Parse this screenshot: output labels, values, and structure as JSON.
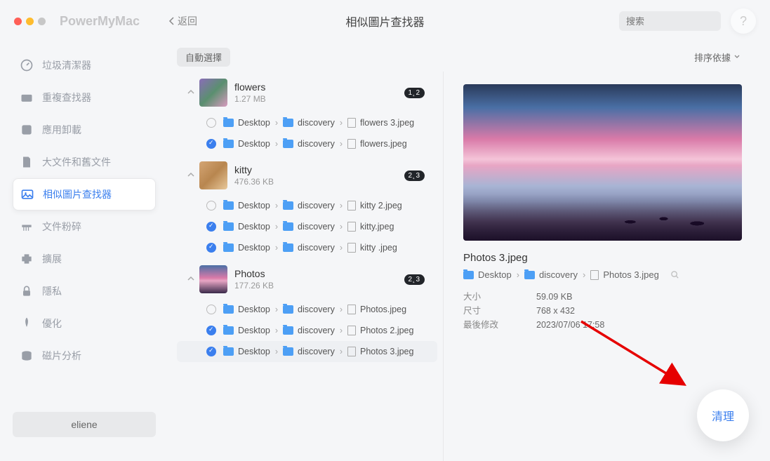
{
  "app_name": "PowerMyMac",
  "back_label": "返回",
  "page_title": "相似圖片查找器",
  "search_placeholder": "搜索",
  "help_glyph": "?",
  "sidebar": {
    "items": [
      {
        "icon": "gauge",
        "label": "垃圾清潔器"
      },
      {
        "icon": "dup",
        "label": "重複查找器"
      },
      {
        "icon": "app",
        "label": "應用卸載"
      },
      {
        "icon": "file",
        "label": "大文件和舊文件"
      },
      {
        "icon": "img",
        "label": "相似圖片查找器"
      },
      {
        "icon": "shred",
        "label": "文件粉碎"
      },
      {
        "icon": "ext",
        "label": "擴展"
      },
      {
        "icon": "lock",
        "label": "隱私"
      },
      {
        "icon": "opt",
        "label": "優化"
      },
      {
        "icon": "disk",
        "label": "磁片分析"
      }
    ]
  },
  "user_name": "eliene",
  "toolbar": {
    "auto_select": "自動選擇",
    "sort_label": "排序依據"
  },
  "groups": [
    {
      "name": "flowers",
      "size": "1.27 MB",
      "badge": "1˛2",
      "files": [
        {
          "checked": false,
          "path": [
            "Desktop",
            "discovery"
          ],
          "file": "flowers 3.jpeg"
        },
        {
          "checked": true,
          "path": [
            "Desktop",
            "discovery"
          ],
          "file": "flowers.jpeg"
        }
      ]
    },
    {
      "name": "kitty",
      "size": "476.36 KB",
      "badge": "2˛3",
      "files": [
        {
          "checked": false,
          "path": [
            "Desktop",
            "discovery"
          ],
          "file": "kitty 2.jpeg"
        },
        {
          "checked": true,
          "path": [
            "Desktop",
            "discovery"
          ],
          "file": "kitty.jpeg"
        },
        {
          "checked": true,
          "path": [
            "Desktop",
            "discovery"
          ],
          "file": "kitty .jpeg"
        }
      ]
    },
    {
      "name": "Photos",
      "size": "177.26 KB",
      "badge": "2˛3",
      "files": [
        {
          "checked": false,
          "path": [
            "Desktop",
            "discovery"
          ],
          "file": "Photos.jpeg"
        },
        {
          "checked": true,
          "path": [
            "Desktop",
            "discovery"
          ],
          "file": "Photos 2.jpeg"
        },
        {
          "checked": true,
          "path": [
            "Desktop",
            "discovery"
          ],
          "file": "Photos 3.jpeg",
          "selected": true
        }
      ]
    }
  ],
  "preview": {
    "filename": "Photos 3.jpeg",
    "path": [
      "Desktop",
      "discovery",
      "Photos 3.jpeg"
    ],
    "meta": {
      "size_label": "大小",
      "size_value": "59.09 KB",
      "dim_label": "尺寸",
      "dim_value": "768 x 432",
      "mod_label": "最後修改",
      "mod_value": "2023/07/06 17:58"
    }
  },
  "clean_label": "清理"
}
